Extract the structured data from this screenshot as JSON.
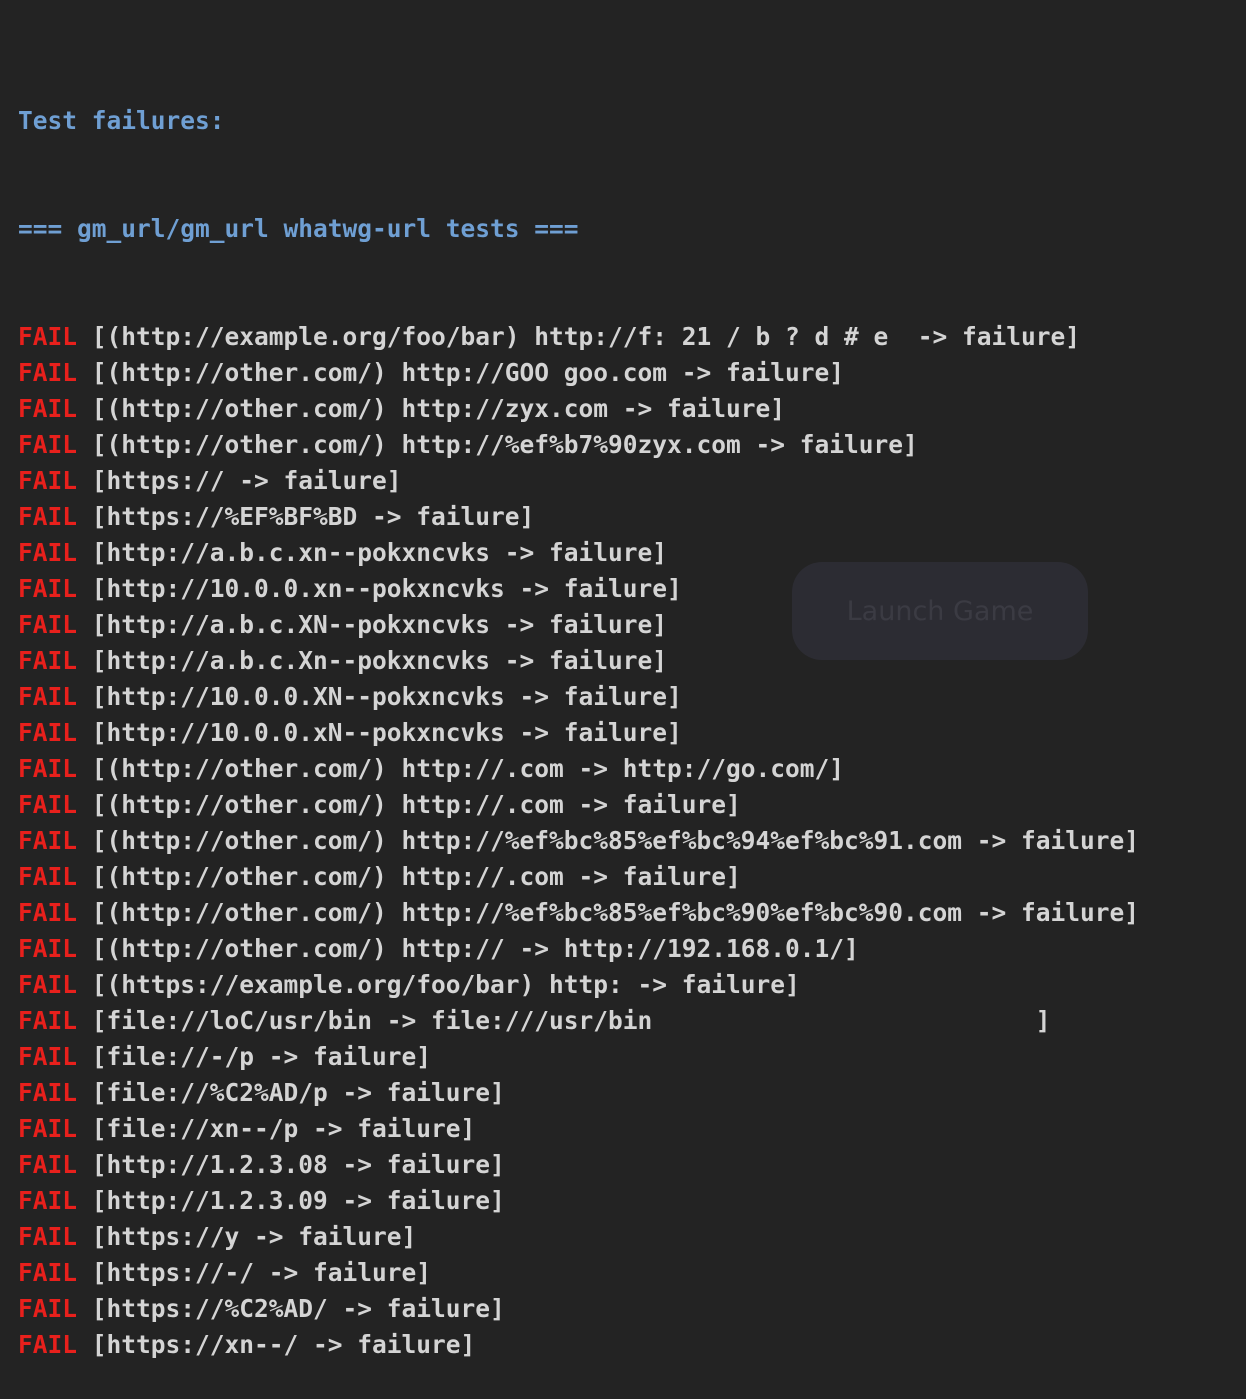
{
  "terminal": {
    "header_line_1": "Test failures:",
    "header_line_2": "=== gm_url/gm_url whatwg-url tests ===",
    "fail_label": "FAIL",
    "lines": [
      "[(http://example.org/foo/bar) http://f: 21 / b ? d # e  -> failure]",
      "[(http://other.com/) http://GOO goo.com -> failure]",
      "[(http://other.com/) http://zyx.com -> failure]",
      "[(http://other.com/) http://%ef%b7%90zyx.com -> failure]",
      "[https:// -> failure]",
      "[https://%EF%BF%BD -> failure]",
      "[http://a.b.c.xn--pokxncvks -> failure]",
      "[http://10.0.0.xn--pokxncvks -> failure]",
      "[http://a.b.c.XN--pokxncvks -> failure]",
      "[http://a.b.c.Xn--pokxncvks -> failure]",
      "[http://10.0.0.XN--pokxncvks -> failure]",
      "[http://10.0.0.xN--pokxncvks -> failure]",
      "[(http://other.com/) http://.com -> http://go.com/]",
      "[(http://other.com/) http://.com -> failure]",
      "[(http://other.com/) http://%ef%bc%85%ef%bc%94%ef%bc%91.com -> failure]",
      "[(http://other.com/) http://.com -> failure]",
      "[(http://other.com/) http://%ef%bc%85%ef%bc%90%ef%bc%90.com -> failure]",
      "[(http://other.com/) http:// -> http://192.168.0.1/]",
      "[(https://example.org/foo/bar) http: -> failure]",
      "[file://loC/usr/bin -> file:///usr/bin                          ]",
      "[file://-/p -> failure]",
      "[file://%C2%AD/p -> failure]",
      "[file://xn--/p -> failure]",
      "[http://1.2.3.08 -> failure]",
      "[http://1.2.3.09 -> failure]",
      "[https://y -> failure]",
      "[https://-/ -> failure]",
      "[https://%C2%AD/ -> failure]",
      "[https://xn--/ -> failure]"
    ]
  },
  "overlay": {
    "label": "Launch Game"
  },
  "colors": {
    "background": "#232323",
    "header": "#6f9fd3",
    "fail": "#e8201c",
    "text": "#d4d4d4"
  }
}
